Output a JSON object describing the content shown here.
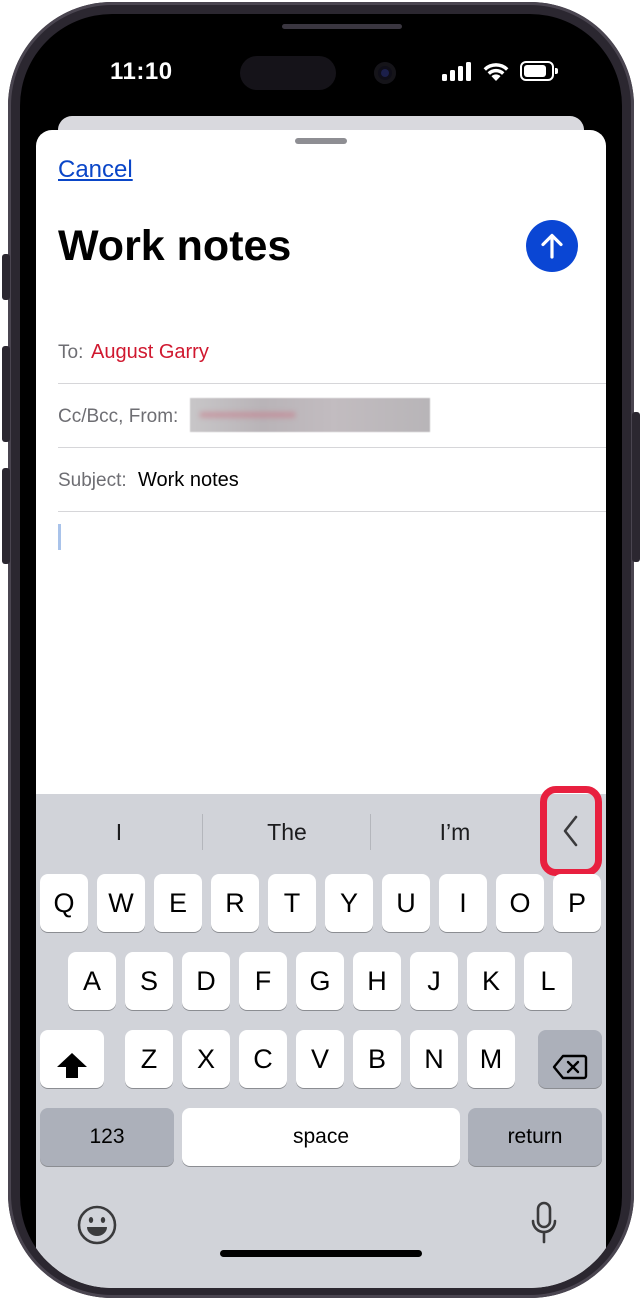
{
  "status_bar": {
    "time": "11:10"
  },
  "compose": {
    "cancel_label": "Cancel",
    "title": "Work notes",
    "send_icon": "arrow-up-icon",
    "to_label": "To:",
    "to_value": "August Garry",
    "cc_label": "Cc/Bcc, From:",
    "from_value_redacted": true,
    "subject_label": "Subject:",
    "subject_value": "Work notes"
  },
  "keyboard": {
    "predictions": [
      "I",
      "The",
      "I’m"
    ],
    "collapse_icon": "chevron-left-icon",
    "rows": [
      [
        "Q",
        "W",
        "E",
        "R",
        "T",
        "Y",
        "U",
        "I",
        "O",
        "P"
      ],
      [
        "A",
        "S",
        "D",
        "F",
        "G",
        "H",
        "J",
        "K",
        "L"
      ],
      [
        "Z",
        "X",
        "C",
        "V",
        "B",
        "N",
        "M"
      ]
    ],
    "shift_icon": "shift-icon",
    "delete_icon": "backspace-icon",
    "numbers_label": "123",
    "space_label": "space",
    "return_label": "return",
    "emoji_icon": "emoji-icon",
    "mic_icon": "microphone-icon"
  },
  "colors": {
    "accent_blue": "#0a46d4",
    "recipient_red": "#d0182f",
    "highlight_red": "#e8203f",
    "keyboard_bg": "#d1d3d9"
  }
}
